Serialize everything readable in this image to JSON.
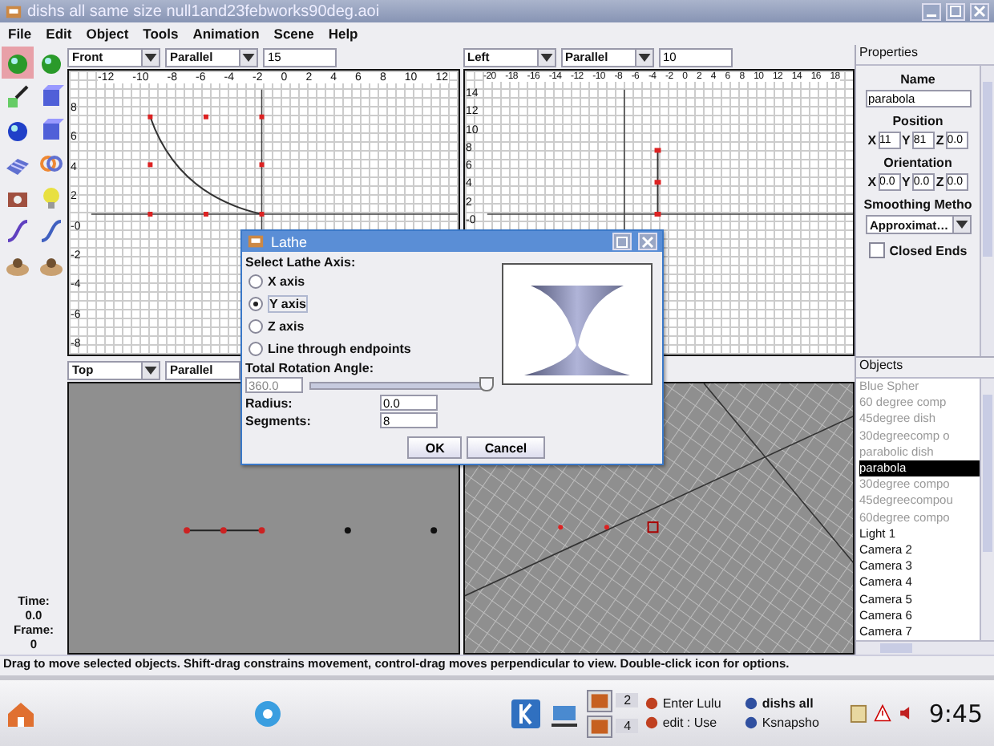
{
  "window": {
    "title": "dishs all same size null1and23febworks90deg.aoi"
  },
  "menu": [
    "File",
    "Edit",
    "Object",
    "Tools",
    "Animation",
    "Scene",
    "Help"
  ],
  "tools": [
    {
      "selected": true
    },
    {
      "selected": false
    },
    {
      "selected": false
    },
    {
      "selected": false
    },
    {
      "selected": false
    },
    {
      "selected": false
    },
    {
      "selected": false
    },
    {
      "selected": false
    },
    {
      "selected": false
    },
    {
      "selected": false
    },
    {
      "selected": false
    },
    {
      "selected": false
    },
    {
      "selected": false
    },
    {
      "selected": false
    }
  ],
  "viewports": [
    {
      "kind": "front",
      "view": "Front",
      "projection": "Parallel",
      "scale": "15",
      "x_ticks": [
        "-12",
        "-10",
        "-8",
        "-6",
        "-4",
        "-2",
        "0",
        "2",
        "4",
        "6",
        "8",
        "10",
        "12"
      ],
      "y_ticks": [
        "8",
        "6",
        "4",
        "2",
        "-0",
        "-2",
        "-4",
        "-6",
        "-8"
      ]
    },
    {
      "kind": "side",
      "view": "Left",
      "projection": "Parallel",
      "scale": "10",
      "x_ticks": [
        "-20",
        "-18",
        "-16",
        "-14",
        "-12",
        "-10",
        "-8",
        "-6",
        "-4",
        "-2",
        "0",
        "2",
        "4",
        "6",
        "8",
        "10",
        "12",
        "14",
        "16",
        "18"
      ],
      "y_ticks": [
        "14",
        "12",
        "10",
        "8",
        "6",
        "4",
        "2",
        "-0"
      ]
    },
    {
      "kind": "top",
      "view": "Top",
      "projection": "Parallel"
    },
    {
      "kind": "perspective"
    }
  ],
  "time": {
    "time_label": "Time:",
    "time": "0.0",
    "frame_label": "Frame:",
    "frame": "0"
  },
  "properties": {
    "header": "Properties",
    "name_label": "Name",
    "name": "parabola",
    "position_label": "Position",
    "position": [
      {
        "axis": "X",
        "value": "11"
      },
      {
        "axis": "Y",
        "value": "81"
      },
      {
        "axis": "Z",
        "value": "0.0"
      }
    ],
    "orientation_label": "Orientation",
    "orientation": [
      {
        "axis": "X",
        "value": "0.0"
      },
      {
        "axis": "Y",
        "value": "0.0"
      },
      {
        "axis": "Z",
        "value": "0.0"
      }
    ],
    "smoothing_label": "Smoothing Metho",
    "smoothing": "Approximat…",
    "closed_ends": {
      "label": "Closed Ends",
      "checked": false
    }
  },
  "objects": {
    "header": "Objects",
    "items": [
      {
        "label": "Blue Spher",
        "hidden": true,
        "selected": false
      },
      {
        "label": "60 degree comp",
        "hidden": true,
        "selected": false
      },
      {
        "label": "45degree dish",
        "hidden": true,
        "selected": false
      },
      {
        "label": "30degreecomp o",
        "hidden": true,
        "selected": false
      },
      {
        "label": "parabolic dish",
        "hidden": true,
        "selected": false
      },
      {
        "label": "parabola",
        "hidden": false,
        "selected": true
      },
      {
        "label": "30degree compo",
        "hidden": true,
        "selected": false
      },
      {
        "label": "45degreecompou",
        "hidden": true,
        "selected": false
      },
      {
        "label": "60degree compo",
        "hidden": true,
        "selected": false
      },
      {
        "label": "Light 1",
        "hidden": false,
        "selected": false
      },
      {
        "label": "Camera 2",
        "hidden": false,
        "selected": false
      },
      {
        "label": "Camera 3",
        "hidden": false,
        "selected": false
      },
      {
        "label": "Camera 4",
        "hidden": false,
        "selected": false
      },
      {
        "label": "Camera 5",
        "hidden": false,
        "selected": false
      },
      {
        "label": "Camera 6",
        "hidden": false,
        "selected": false
      },
      {
        "label": "Camera 7",
        "hidden": false,
        "selected": false
      }
    ]
  },
  "status_bar": "Drag to move selected objects.  Shift-drag constrains movement, control-drag moves perpendicular to view.  Double-click icon for options.",
  "dialog": {
    "title": "Lathe",
    "axis_label": "Select Lathe Axis:",
    "axes": [
      {
        "label": "X axis",
        "selected": false
      },
      {
        "label": "Y axis",
        "selected": true
      },
      {
        "label": "Z axis",
        "selected": false
      },
      {
        "label": "Line through endpoints",
        "selected": false
      }
    ],
    "angle_label": "Total Rotation Angle:",
    "angle": "360.0",
    "slider": {
      "level": 1
    },
    "radius_label": "Radius:",
    "radius": "0.0",
    "segments_label": "Segments:",
    "segments": "8",
    "buttons": [
      "OK",
      "Cancel"
    ]
  },
  "taskbar": {
    "desktops": [
      "2",
      "4"
    ],
    "tasks": [
      {
        "label": "Enter Lulu",
        "selected": false
      },
      {
        "label": "dishs all",
        "selected": true
      },
      {
        "label": "edit : Use",
        "selected": false
      },
      {
        "label": "Ksnapsho",
        "selected": false
      }
    ],
    "clock": "9:45"
  }
}
